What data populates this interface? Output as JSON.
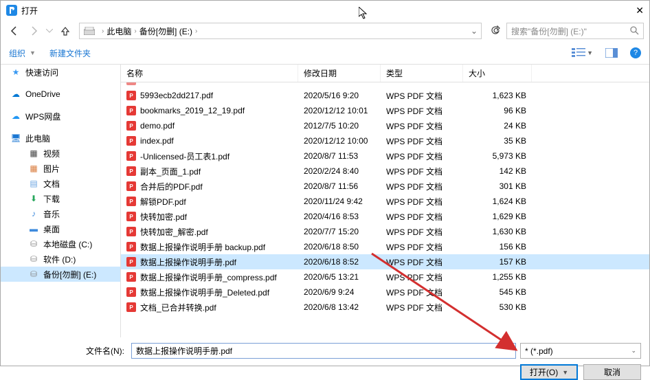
{
  "window": {
    "title": "打开"
  },
  "nav": {
    "crumbs": [
      "此电脑",
      "备份[勿删] (E:)"
    ],
    "search_placeholder": "搜索\"备份[勿删] (E:)\""
  },
  "toolbar": {
    "organize": "组织",
    "newfolder": "新建文件夹"
  },
  "sidebar": {
    "items": [
      {
        "label": "快速访问",
        "icon": "star",
        "color": "#3a99f2",
        "indent": 0
      },
      {
        "label": "OneDrive",
        "icon": "cloud",
        "color": "#0078d4",
        "indent": 0
      },
      {
        "label": "WPS网盘",
        "icon": "cloud",
        "color": "#2196f3",
        "indent": 0
      },
      {
        "label": "此电脑",
        "icon": "monitor",
        "color": "#1976d2",
        "indent": 0
      },
      {
        "label": "视频",
        "icon": "video",
        "color": "#444",
        "indent": 1
      },
      {
        "label": "图片",
        "icon": "image",
        "color": "#d97b3c",
        "indent": 1
      },
      {
        "label": "文档",
        "icon": "doc",
        "color": "#6aa4e0",
        "indent": 1
      },
      {
        "label": "下载",
        "icon": "download",
        "color": "#26a65b",
        "indent": 1
      },
      {
        "label": "音乐",
        "icon": "music",
        "color": "#3f8bdd",
        "indent": 1
      },
      {
        "label": "桌面",
        "icon": "desktop",
        "color": "#3f8bdd",
        "indent": 1
      },
      {
        "label": "本地磁盘 (C:)",
        "icon": "drive",
        "color": "#888",
        "indent": 1
      },
      {
        "label": "软件 (D:)",
        "icon": "drive",
        "color": "#888",
        "indent": 1
      },
      {
        "label": "备份[勿删] (E:)",
        "icon": "drive",
        "color": "#888",
        "indent": 1,
        "selected": true
      }
    ]
  },
  "headers": {
    "name": "名称",
    "date": "修改日期",
    "type": "类型",
    "size": "大小"
  },
  "files": [
    {
      "name": "5993ecb2dd217.pdf",
      "date": "2020/5/16 9:20",
      "type": "WPS PDF 文档",
      "size": "1,623 KB"
    },
    {
      "name": "bookmarks_2019_12_19.pdf",
      "date": "2020/12/12 10:01",
      "type": "WPS PDF 文档",
      "size": "96 KB"
    },
    {
      "name": "demo.pdf",
      "date": "2012/7/5 10:20",
      "type": "WPS PDF 文档",
      "size": "24 KB"
    },
    {
      "name": "index.pdf",
      "date": "2020/12/12 10:00",
      "type": "WPS PDF 文档",
      "size": "35 KB"
    },
    {
      "name": "-Unlicensed-员工表1.pdf",
      "date": "2020/8/7 11:53",
      "type": "WPS PDF 文档",
      "size": "5,973 KB"
    },
    {
      "name": "副本_页面_1.pdf",
      "date": "2020/2/24 8:40",
      "type": "WPS PDF 文档",
      "size": "142 KB"
    },
    {
      "name": "合并后的PDF.pdf",
      "date": "2020/8/7 11:56",
      "type": "WPS PDF 文档",
      "size": "301 KB"
    },
    {
      "name": "解锁PDF.pdf",
      "date": "2020/11/24 9:42",
      "type": "WPS PDF 文档",
      "size": "1,624 KB"
    },
    {
      "name": "快转加密.pdf",
      "date": "2020/4/16 8:53",
      "type": "WPS PDF 文档",
      "size": "1,629 KB"
    },
    {
      "name": "快转加密_解密.pdf",
      "date": "2020/7/7 15:20",
      "type": "WPS PDF 文档",
      "size": "1,630 KB"
    },
    {
      "name": "数据上报操作说明手册 backup.pdf",
      "date": "2020/6/18 8:50",
      "type": "WPS PDF 文档",
      "size": "156 KB"
    },
    {
      "name": "数据上报操作说明手册.pdf",
      "date": "2020/6/18 8:52",
      "type": "WPS PDF 文档",
      "size": "157 KB",
      "selected": true
    },
    {
      "name": "数据上报操作说明手册_compress.pdf",
      "date": "2020/6/5 13:21",
      "type": "WPS PDF 文档",
      "size": "1,255 KB"
    },
    {
      "name": "数据上报操作说明手册_Deleted.pdf",
      "date": "2020/6/9 9:24",
      "type": "WPS PDF 文档",
      "size": "545 KB"
    },
    {
      "name": "文档_已合并转换.pdf",
      "date": "2020/6/8 13:42",
      "type": "WPS PDF 文档",
      "size": "530 KB"
    }
  ],
  "footer": {
    "filename_label": "文件名(N):",
    "filename_value": "数据上报操作说明手册.pdf",
    "filetype": "* (*.pdf)",
    "open": "打开(O)",
    "cancel": "取消"
  }
}
